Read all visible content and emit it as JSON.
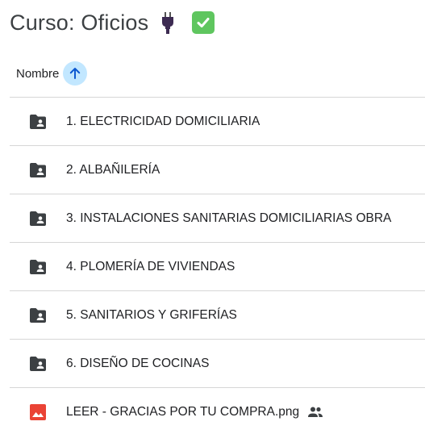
{
  "header": {
    "title": "Curso: Oficios",
    "title_icons": [
      "electric-plug-icon",
      "check-mark-button-icon"
    ]
  },
  "columns": {
    "name_label": "Nombre",
    "sort_icon": "arrow-up-icon",
    "sort_direction": "ascending"
  },
  "items": [
    {
      "name": "1. ELECTRICIDAD DOMICILIARIA",
      "type": "shared-folder",
      "icon": "shared-folder-icon"
    },
    {
      "name": "2. ALBAÑILERÍA",
      "type": "shared-folder",
      "icon": "shared-folder-icon"
    },
    {
      "name": "3. INSTALACIONES SANITARIAS DOMICILIARIAS OBRA",
      "type": "shared-folder",
      "icon": "shared-folder-icon"
    },
    {
      "name": "4. PLOMERÍA DE VIVIENDAS",
      "type": "shared-folder",
      "icon": "shared-folder-icon"
    },
    {
      "name": "5. SANITARIOS Y GRIFERÍAS",
      "type": "shared-folder",
      "icon": "shared-folder-icon"
    },
    {
      "name": "6. DISEÑO DE COCINAS",
      "type": "shared-folder",
      "icon": "shared-folder-icon"
    },
    {
      "name": "LEER - GRACIAS POR TU COMPRA.png",
      "type": "image",
      "icon": "image-file-icon",
      "shared_icon": "people-icon"
    }
  ],
  "colors": {
    "folder": "#3c4043",
    "image_file": "#ea4335",
    "sort_button_bg": "#c2e7ff",
    "sort_arrow": "#0b57d0",
    "check_green": "#5fc65f",
    "divider": "#d6d6d6"
  }
}
